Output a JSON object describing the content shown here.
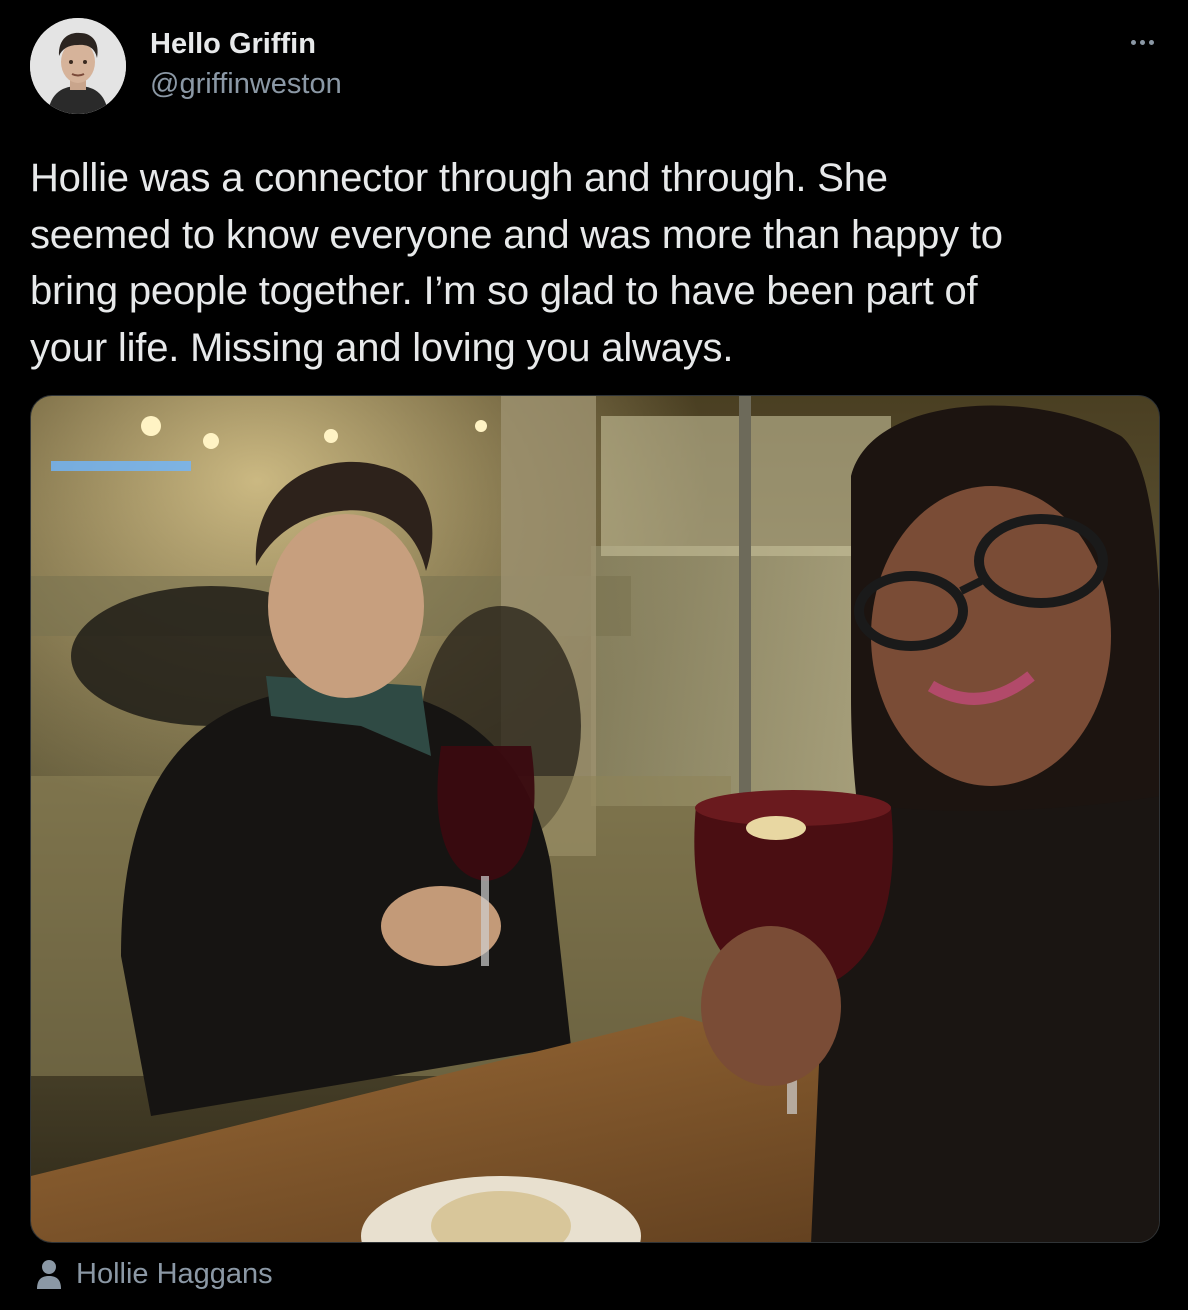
{
  "tweet": {
    "display_name": "Hello Griffin",
    "handle": "@griffinweston",
    "text": "Hollie was a connector through and through. She\nseemed to know everyone and was more than happy to\nbring people together. I’m so glad to have been part of\nyour life. Missing and loving you always.",
    "avatar_icon": "profile-photo",
    "more_icon": "more-dots-icon",
    "media": {
      "description_icon": "photo"
    },
    "tagged_user": {
      "icon": "person-icon",
      "name": "Hollie Haggans"
    }
  },
  "colors": {
    "background": "#000000",
    "primary_text": "#e7e9ea",
    "secondary_text": "#8b98a5",
    "border": "#2f3336"
  }
}
